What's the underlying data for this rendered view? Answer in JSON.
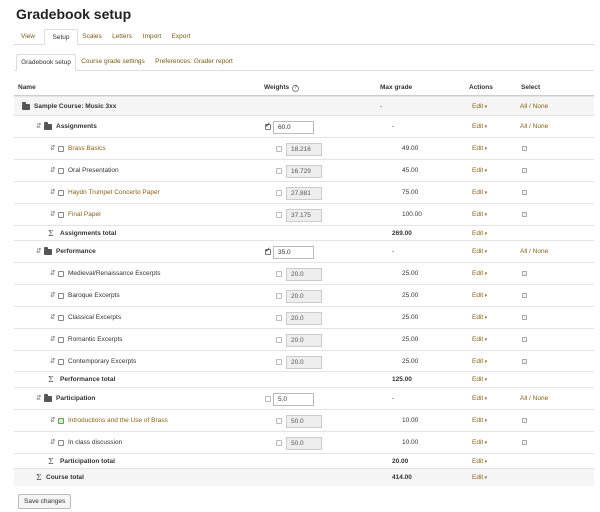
{
  "page_title": "Gradebook setup",
  "tabs": [
    {
      "label": "View",
      "active": false
    },
    {
      "label": "Setup",
      "active": true
    },
    {
      "label": "Scales",
      "active": false
    },
    {
      "label": "Letters",
      "active": false
    },
    {
      "label": "Import",
      "active": false
    },
    {
      "label": "Export",
      "active": false
    }
  ],
  "subtabs": [
    {
      "label": "Gradebook setup",
      "active": true
    },
    {
      "label": "Course grade settings",
      "active": false
    },
    {
      "label": "Preferences: Grader report",
      "active": false
    }
  ],
  "columns": {
    "name": "Name",
    "weights": "Weights",
    "max_grade": "Max grade",
    "actions": "Actions",
    "select": "Select"
  },
  "rows": [
    {
      "kind": "course",
      "name": "Sample Course: Music 3xx",
      "max": "-",
      "edit": "Edit",
      "select": "All / None"
    },
    {
      "kind": "category",
      "name": "Assignments",
      "checked": true,
      "weight": "60.0",
      "max": "-",
      "edit": "Edit",
      "select": "All / None"
    },
    {
      "kind": "item",
      "name": "Brass Basics",
      "link": true,
      "icon": "assignment",
      "weight": "18.216",
      "max": "49.00",
      "edit": "Edit"
    },
    {
      "kind": "item",
      "name": "Oral Presentation",
      "link": false,
      "icon": "manual",
      "weight": "16.729",
      "max": "45.00",
      "edit": "Edit"
    },
    {
      "kind": "item",
      "name": "Haydn Trumpet Concerto Paper",
      "link": true,
      "icon": "assignment",
      "weight": "27.881",
      "max": "75.00",
      "edit": "Edit"
    },
    {
      "kind": "item",
      "name": "Final Paper",
      "link": true,
      "icon": "assignment",
      "weight": "37.175",
      "max": "100.00",
      "edit": "Edit"
    },
    {
      "kind": "total",
      "name": "Assignments total",
      "max": "269.00",
      "edit": "Edit"
    },
    {
      "kind": "category",
      "name": "Performance",
      "checked": true,
      "weight": "35.0",
      "max": "-",
      "edit": "Edit",
      "select": "All / None"
    },
    {
      "kind": "item",
      "name": "Medieval/Renaissance Excerpts",
      "link": false,
      "icon": "manual",
      "weight": "20.0",
      "max": "25.00",
      "edit": "Edit"
    },
    {
      "kind": "item",
      "name": "Baroque Excerpts",
      "link": false,
      "icon": "manual",
      "weight": "20.0",
      "max": "25.00",
      "edit": "Edit"
    },
    {
      "kind": "item",
      "name": "Classical Excerpts",
      "link": false,
      "icon": "manual",
      "weight": "20.0",
      "max": "25.00",
      "edit": "Edit"
    },
    {
      "kind": "item",
      "name": "Romantic Excerpts",
      "link": false,
      "icon": "manual",
      "weight": "20.0",
      "max": "25.00",
      "edit": "Edit"
    },
    {
      "kind": "item",
      "name": "Contemporary Excerpts",
      "link": false,
      "icon": "manual",
      "weight": "20.0",
      "max": "25.00",
      "edit": "Edit"
    },
    {
      "kind": "total",
      "name": "Performance total",
      "max": "125.00",
      "edit": "Edit"
    },
    {
      "kind": "category",
      "name": "Participation",
      "checked": false,
      "weight": "5.0",
      "max": "-",
      "edit": "Edit",
      "select": "All / None"
    },
    {
      "kind": "item",
      "name": "Introductions and the Use of Brass",
      "link": true,
      "icon": "forum",
      "weight": "50.0",
      "max": "10.00",
      "edit": "Edit"
    },
    {
      "kind": "item",
      "name": "In class discussion",
      "link": false,
      "icon": "manual",
      "weight": "50.0",
      "max": "10.00",
      "edit": "Edit"
    },
    {
      "kind": "total",
      "name": "Participation total",
      "max": "20.00",
      "edit": "Edit"
    },
    {
      "kind": "coursetotal",
      "name": "Course total",
      "max": "414.00",
      "edit": "Edit"
    }
  ],
  "save_button": "Save changes",
  "colors": {
    "link": "#8a6216",
    "border": "#dddddd"
  }
}
